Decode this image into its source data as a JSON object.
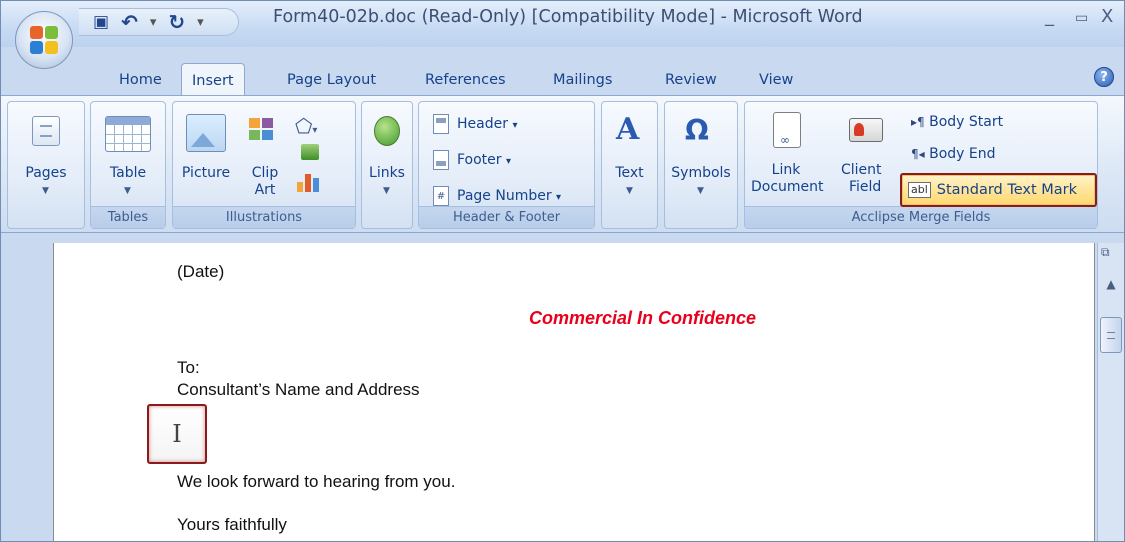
{
  "window": {
    "title": "Form40-02b.doc (Read-Only) [Compatibility Mode] - Microsoft Word",
    "minimize": "_",
    "maximize": "▭",
    "close": "X"
  },
  "quick_access": {
    "save_icon": "save-icon",
    "undo_icon": "undo-icon",
    "redo_icon": "redo-icon",
    "customize_icon": "customize-qat-icon"
  },
  "tabs": [
    "Home",
    "Insert",
    "Page Layout",
    "References",
    "Mailings",
    "Review",
    "View"
  ],
  "active_tab": "Insert",
  "ribbon": {
    "pages": {
      "label": "Pages"
    },
    "tables": {
      "button": "Table",
      "group": "Tables"
    },
    "illustrations": {
      "picture": "Picture",
      "clip_art_line1": "Clip",
      "clip_art_line2": "Art",
      "group": "Illustrations"
    },
    "links": {
      "button": "Links"
    },
    "header_footer": {
      "header": "Header",
      "footer": "Footer",
      "page_number": "Page Number",
      "group": "Header & Footer"
    },
    "text": {
      "button": "Text"
    },
    "symbols": {
      "button": "Symbols"
    },
    "acclipse": {
      "link_document_line1": "Link",
      "link_document_line2": "Document",
      "client_field_line1": "Client",
      "client_field_line2": "Field",
      "body_start": "Body Start",
      "body_end": "Body End",
      "standard_text_mark": "Standard Text Mark",
      "abl": "abl",
      "group": "Acclipse Merge Fields"
    }
  },
  "document": {
    "date": "(Date)",
    "confidential": "Commercial In Confidence",
    "to": "To:",
    "consultant": "Consultant’s Name and Address",
    "closing_line": "We look forward to hearing  from you.",
    "signoff": "Yours faithfully"
  }
}
